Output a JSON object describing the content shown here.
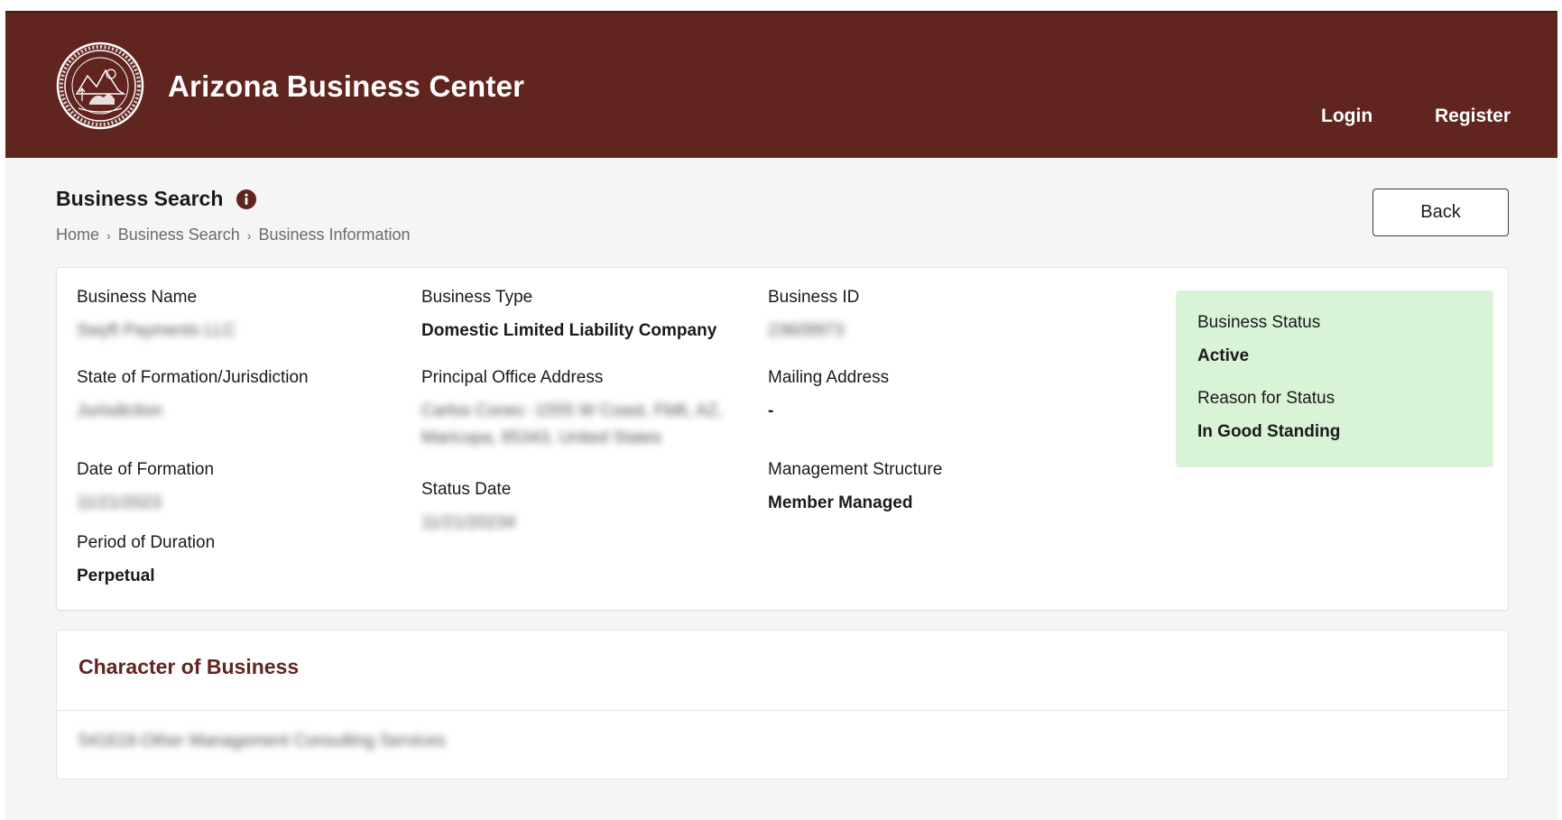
{
  "header": {
    "app_title": "Arizona Business Center",
    "nav": {
      "login": "Login",
      "register": "Register"
    }
  },
  "page": {
    "title": "Business Search",
    "breadcrumb": [
      "Home",
      "Business Search",
      "Business Information"
    ],
    "back_label": "Back"
  },
  "details": {
    "business_name": {
      "label": "Business Name",
      "value": "Swyft Payments LLC"
    },
    "business_type": {
      "label": "Business Type",
      "value": "Domestic Limited Liability Company"
    },
    "business_id": {
      "label": "Business ID",
      "value": "23609973"
    },
    "state_of_formation": {
      "label": "State of Formation/Jurisdiction",
      "value": "Jurisdiction"
    },
    "principal_office_address": {
      "label": "Principal Office Address",
      "value_line1": "Carlos Conec -1555 W Coast, Fbl6, AZ,",
      "value_line2": "Maricopa, 85343, United States"
    },
    "mailing_address": {
      "label": "Mailing Address",
      "value": "-"
    },
    "date_of_formation": {
      "label": "Date of Formation",
      "value": "11/21/2023"
    },
    "status_date": {
      "label": "Status Date",
      "value": "11/21/20234"
    },
    "management_structure": {
      "label": "Management Structure",
      "value": "Member Managed"
    },
    "period_of_duration": {
      "label": "Period of Duration",
      "value": "Perpetual"
    }
  },
  "status": {
    "business_status": {
      "label": "Business Status",
      "value": "Active"
    },
    "reason_for_status": {
      "label": "Reason for Status",
      "value": "In Good Standing"
    },
    "background_color": "#d9f3d6"
  },
  "character_of_business": {
    "title": "Character of Business",
    "value": "541618-Other Management Consulting Services"
  },
  "colors": {
    "brand": "#612520",
    "page_bg": "#f5f5f6"
  },
  "icons": {
    "seal": "arizona-state-seal-icon",
    "info": "info-icon",
    "breadcrumb_separator": "chevron-right-icon"
  }
}
